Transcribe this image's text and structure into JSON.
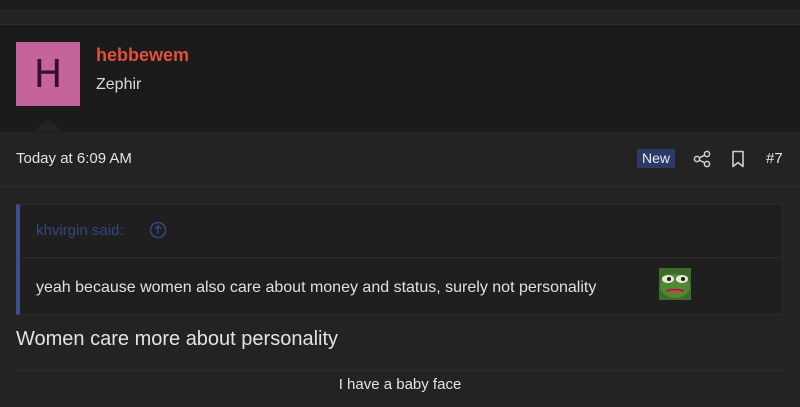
{
  "user": {
    "avatar_letter": "H",
    "username": "hebbewem",
    "title": "Zephir"
  },
  "post": {
    "timestamp": "Today at 6:09 AM",
    "badge": "New",
    "number": "#7",
    "quote": {
      "author": "khvirgin said:",
      "text": "yeah because women also care about money and status, surely not personality"
    },
    "reply": "Women care more about personality",
    "signature": "I have a baby face"
  },
  "icons": {
    "share": "share-icon",
    "bookmark": "bookmark-icon",
    "quote_link": "arrow-up-circle-icon",
    "emoji": "pepe-emoji-icon"
  },
  "colors": {
    "username": "#e0503f",
    "avatar_bg": "#c5639c",
    "badge_bg": "#2b3a66",
    "quote_bar": "#3c4f8c"
  }
}
